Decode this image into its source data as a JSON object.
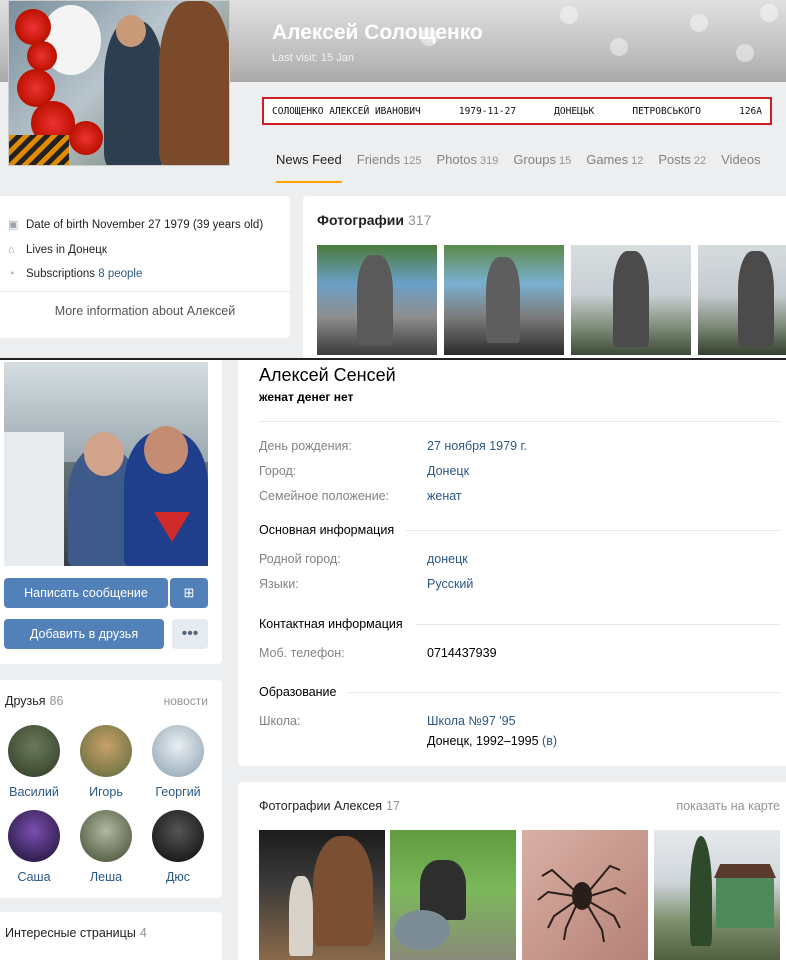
{
  "top": {
    "name": "Алексей Солощенко",
    "last_visit": "Last visit: 15 Jan",
    "highlight": {
      "full_name": "СОЛОЩЕНКО АЛЕКСЕЙ ИВАНОВИЧ",
      "birth": "1979-11-27",
      "city": "ДОНЕЦЬК",
      "street": "ПЕТРОВСЬКОГО",
      "house": "126А",
      "border_color": "#d01c22"
    },
    "tabs": [
      {
        "label": "News Feed",
        "count": ""
      },
      {
        "label": "Friends",
        "count": "125"
      },
      {
        "label": "Photos",
        "count": "319"
      },
      {
        "label": "Groups",
        "count": "15"
      },
      {
        "label": "Games",
        "count": "12"
      },
      {
        "label": "Posts",
        "count": "22"
      },
      {
        "label": "Videos",
        "count": ""
      }
    ],
    "info": {
      "dob": "Date of birth November 27 1979 (39 years old)",
      "lives": "Lives in Донецк",
      "subs_label": "Subscriptions",
      "subs_value": "8 people",
      "more": "More information about Алексей"
    },
    "photos": {
      "title": "Фотографии",
      "count": "317"
    }
  },
  "bottom": {
    "profile": {
      "name": "Алексей Сенсей",
      "status": "женат денег нет"
    },
    "buttons": {
      "message": "Написать сообщение",
      "add_friend": "Добавить в друзья",
      "more": "•••"
    },
    "rows_main": [
      {
        "label": "День рождения:",
        "value": "27 ноября 1979 г."
      },
      {
        "label": "Город:",
        "value": "Донецк"
      },
      {
        "label": "Семейное положение:",
        "value": "женат"
      }
    ],
    "section_basic": "Основная информация",
    "rows_basic": [
      {
        "label": "Родной город:",
        "value": "донецк"
      },
      {
        "label": "Языки:",
        "value": "Русский"
      }
    ],
    "section_contact": "Контактная информация",
    "rows_contact": [
      {
        "label": "Моб. телефон:",
        "value": "0714437939"
      }
    ],
    "section_edu": "Образование",
    "rows_edu": [
      {
        "label": "Школа:",
        "value": "Школа №97 '95",
        "extra": "Донецк, 1992–1995",
        "extra_link": "(в)"
      }
    ],
    "friends": {
      "title": "Друзья",
      "count": "86",
      "news": "новости",
      "items": [
        "Василий",
        "Игорь",
        "Георгий",
        "Саша",
        "Леша",
        "Дюс"
      ]
    },
    "interest": {
      "title": "Интересные страницы",
      "count": "4"
    },
    "photos": {
      "title": "Фотографии Алексея",
      "count": "17",
      "map": "показать на карте"
    }
  },
  "colors": {
    "link": "#2a5885",
    "button": "#5181b8",
    "tab_accent": "#ffa000",
    "page_bg": "#edeef0"
  }
}
